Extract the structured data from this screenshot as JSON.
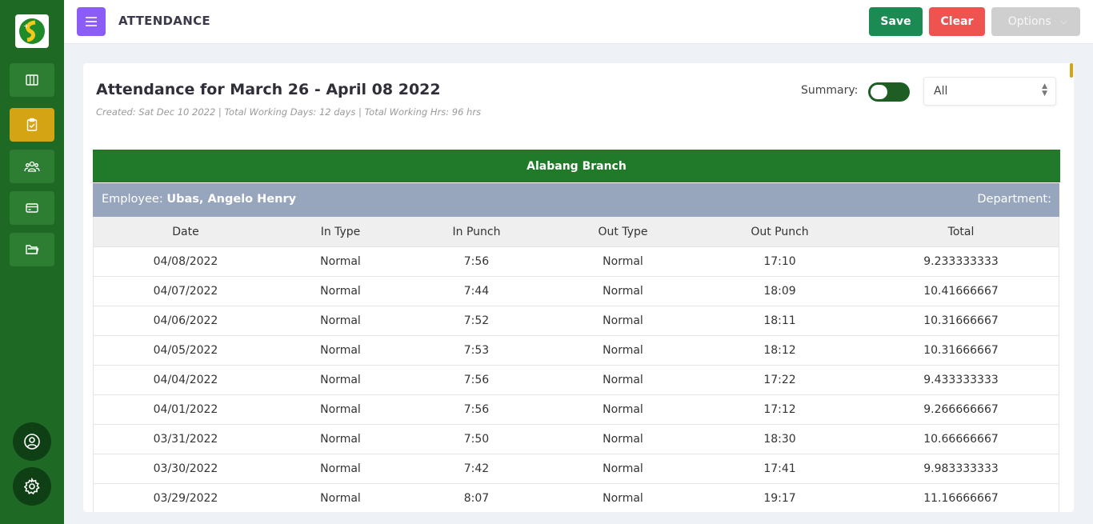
{
  "header": {
    "title": "ATTENDANCE",
    "save_label": "Save",
    "clear_label": "Clear",
    "options_label": "Options"
  },
  "sidebar": {
    "items": [
      "columns-icon",
      "clipboard-check-icon",
      "users-icon",
      "card-icon",
      "folder-icon"
    ],
    "active_index": 1
  },
  "card": {
    "title": "Attendance for March 26 - April 08 2022",
    "subtitle": "Created: Sat Dec 10 2022 | Total Working Days: 12 days | Total Working Hrs: 96 hrs",
    "summary_label": "Summary:",
    "filter_value": "All"
  },
  "branch": "Alabang Branch",
  "employee": {
    "prefix": "Employee:",
    "name": "Ubas, Angelo Henry",
    "department_label": "Department:"
  },
  "table": {
    "columns": [
      "Date",
      "In Type",
      "In Punch",
      "Out Type",
      "Out Punch",
      "Total"
    ],
    "rows": [
      [
        "04/08/2022",
        "Normal",
        "7:56",
        "Normal",
        "17:10",
        "9.233333333"
      ],
      [
        "04/07/2022",
        "Normal",
        "7:44",
        "Normal",
        "18:09",
        "10.41666667"
      ],
      [
        "04/06/2022",
        "Normal",
        "7:52",
        "Normal",
        "18:11",
        "10.31666667"
      ],
      [
        "04/05/2022",
        "Normal",
        "7:53",
        "Normal",
        "18:12",
        "10.31666667"
      ],
      [
        "04/04/2022",
        "Normal",
        "7:56",
        "Normal",
        "17:22",
        "9.433333333"
      ],
      [
        "04/01/2022",
        "Normal",
        "7:56",
        "Normal",
        "17:12",
        "9.266666667"
      ],
      [
        "03/31/2022",
        "Normal",
        "7:50",
        "Normal",
        "18:30",
        "10.66666667"
      ],
      [
        "03/30/2022",
        "Normal",
        "7:42",
        "Normal",
        "17:41",
        "9.983333333"
      ],
      [
        "03/29/2022",
        "Normal",
        "8:07",
        "Normal",
        "19:17",
        "11.16666667"
      ]
    ]
  },
  "colors": {
    "sidebar": "#1e6a24",
    "active": "#d4a414",
    "save": "#1c8a53",
    "clear": "#ef5350",
    "branch": "#217a2a",
    "employee": "#97a6bd",
    "menu": "#8b5cf6"
  }
}
